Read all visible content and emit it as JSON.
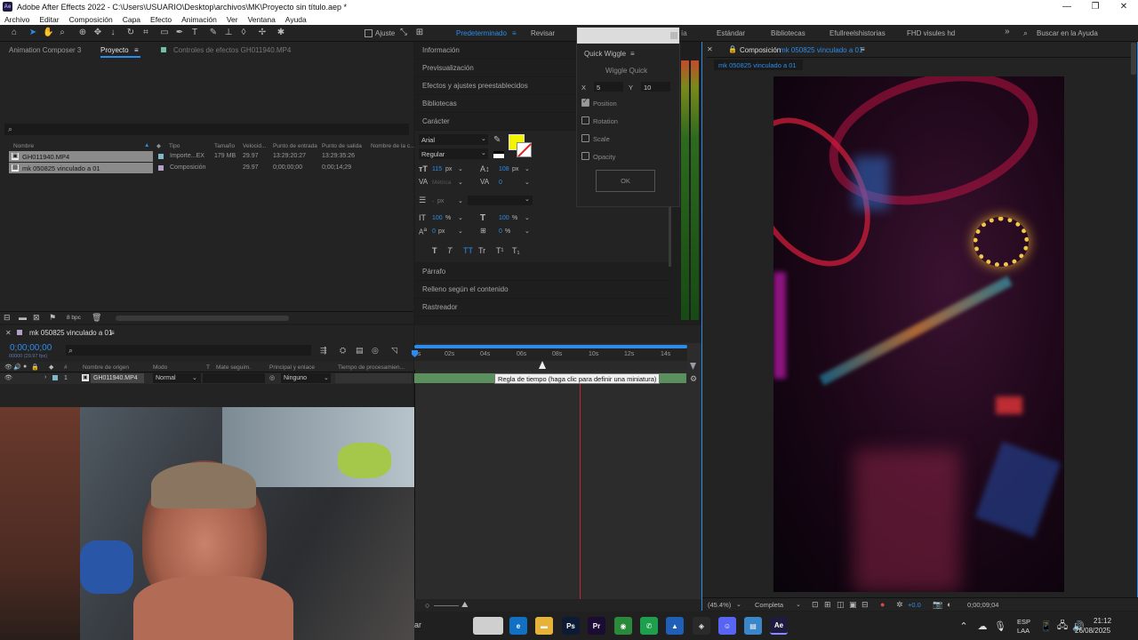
{
  "window": {
    "title": "Adobe After Effects 2022 - C:\\Users\\USUARIO\\Desktop\\archivos\\MK\\Proyecto sin título.aep *",
    "app_badge": "Ae",
    "controls": [
      "—",
      "❐",
      "✕"
    ]
  },
  "menu": [
    "Archivo",
    "Editar",
    "Composición",
    "Capa",
    "Efecto",
    "Animación",
    "Ver",
    "Ventana",
    "Ayuda"
  ],
  "toolbar": {
    "ajuste_label": "Ajuste",
    "workspaces": [
      "Predeterminado",
      "Revisar",
      "Estándar",
      "Bibliotecas",
      "Efullreelshistorias",
      "FHD visules hd"
    ],
    "active_workspace": "Predeterminado",
    "more": "»",
    "search_placeholder": "Buscar en la Ayuda"
  },
  "project_panel": {
    "tabs": [
      "Animation Composer 3",
      "Proyecto",
      "Controles de efectos GH011940.MP4"
    ],
    "active_tab": "Proyecto",
    "search_icon": "⌕",
    "columns": [
      "Nombre",
      "Tipo",
      "Tamaño",
      "Velocid...",
      "Punto de entrada",
      "Punto de salida",
      "Nombre de la c..."
    ],
    "rows": [
      {
        "name": "GH011940.MP4",
        "type": "Importe...EX",
        "size": "179 MB",
        "fps": "29.97",
        "in": "13:29:20:27",
        "out": "13:29:35:26"
      },
      {
        "name": "mk 050825 vinculado a 01",
        "type": "Composición",
        "size": "",
        "fps": "29.97",
        "in": "0;00;00;00",
        "out": "0;00;14;29"
      }
    ],
    "bpc": "8 bpc"
  },
  "side_panels": {
    "items_top": [
      "Información",
      "Previsualización",
      "Efectos y ajustes preestablecidos",
      "Bibliotecas",
      "Carácter"
    ],
    "items_bottom": [
      "Párrafo",
      "Relleno según el contenido",
      "Rastreador"
    ]
  },
  "character": {
    "font": "Arial",
    "style": "Regular",
    "size": "115",
    "size_unit": "px",
    "leading": "108",
    "leading_unit": "px",
    "kerning": "Métrica",
    "tracking": "0",
    "stroke_unit": "px",
    "vscale": "100",
    "hscale": "100",
    "pct": "%",
    "baseline": "0",
    "baseline_unit": "px",
    "tsume": "0",
    "fill_color": "#f4f400",
    "type_buttons": [
      "T",
      "T",
      "TT",
      "Tr",
      "T¹",
      "T₁"
    ]
  },
  "quick_wiggle": {
    "title": "Quick Wiggle",
    "subtitle": "Wiggle Quick",
    "x_label": "X",
    "x_value": "5",
    "y_label": "Y",
    "y_value": "10",
    "options": [
      {
        "label": "Position",
        "checked": true
      },
      {
        "label": "Rotation",
        "checked": false
      },
      {
        "label": "Scale",
        "checked": false
      },
      {
        "label": "Opacity",
        "checked": false
      }
    ],
    "ok_label": "OK",
    "partial_tab": "ía"
  },
  "composition": {
    "tab_prefix": "Composición",
    "tab_name": "mk 050825 vinculado a 01",
    "breadcrumb": "mk 050825 vinculado a 01",
    "zoom": "(45.4%)",
    "resolution": "Completa",
    "exposure": "+0.0",
    "timecode": "0;00;09;04"
  },
  "timeline": {
    "comp_tab": "mk 050825 vinculado a 01",
    "timecode": "0;00;00;00",
    "frames_sub": "00000 (29.97 fps)",
    "columns": [
      "#",
      "Nombre de origen",
      "Modo",
      "T",
      "Mate seguim.",
      "Principal y enlace",
      "Tiempo de procesamien..."
    ],
    "layer": {
      "number": "1",
      "name": "GH011940.MP4",
      "mode": "Normal",
      "parent": "Ninguno"
    },
    "ruler": [
      "0s",
      "02s",
      "04s",
      "06s",
      "08s",
      "10s",
      "12s",
      "14s"
    ],
    "tooltip": "Regla de tiempo (haga clic para definir una miniatura)"
  },
  "taskbar": {
    "search_tail": "ar",
    "apps": [
      {
        "name": "edge",
        "label": "e",
        "color": "#1170c4"
      },
      {
        "name": "explorer",
        "label": "▬",
        "color": "#e6b23a"
      },
      {
        "name": "photoshop",
        "label": "Ps",
        "color": "#0c1b33"
      },
      {
        "name": "premiere",
        "label": "Pr",
        "color": "#1c0b33"
      },
      {
        "name": "chrome",
        "label": "◉",
        "color": "#2a8a3a"
      },
      {
        "name": "whatsapp",
        "label": "✆",
        "color": "#1d9f4d"
      },
      {
        "name": "photos",
        "label": "▲",
        "color": "#1f5fb8"
      },
      {
        "name": "steam",
        "label": "◈",
        "color": "#2a2a2a"
      },
      {
        "name": "discord",
        "label": "☺",
        "color": "#5865f2"
      },
      {
        "name": "notes",
        "label": "▤",
        "color": "#3a86c8"
      },
      {
        "name": "aftereffects",
        "label": "Ae",
        "color": "#1f1b3e"
      }
    ],
    "lang_top": "ESP",
    "lang_bottom": "LAA",
    "time": "21:12",
    "date": "26/08/2025"
  }
}
